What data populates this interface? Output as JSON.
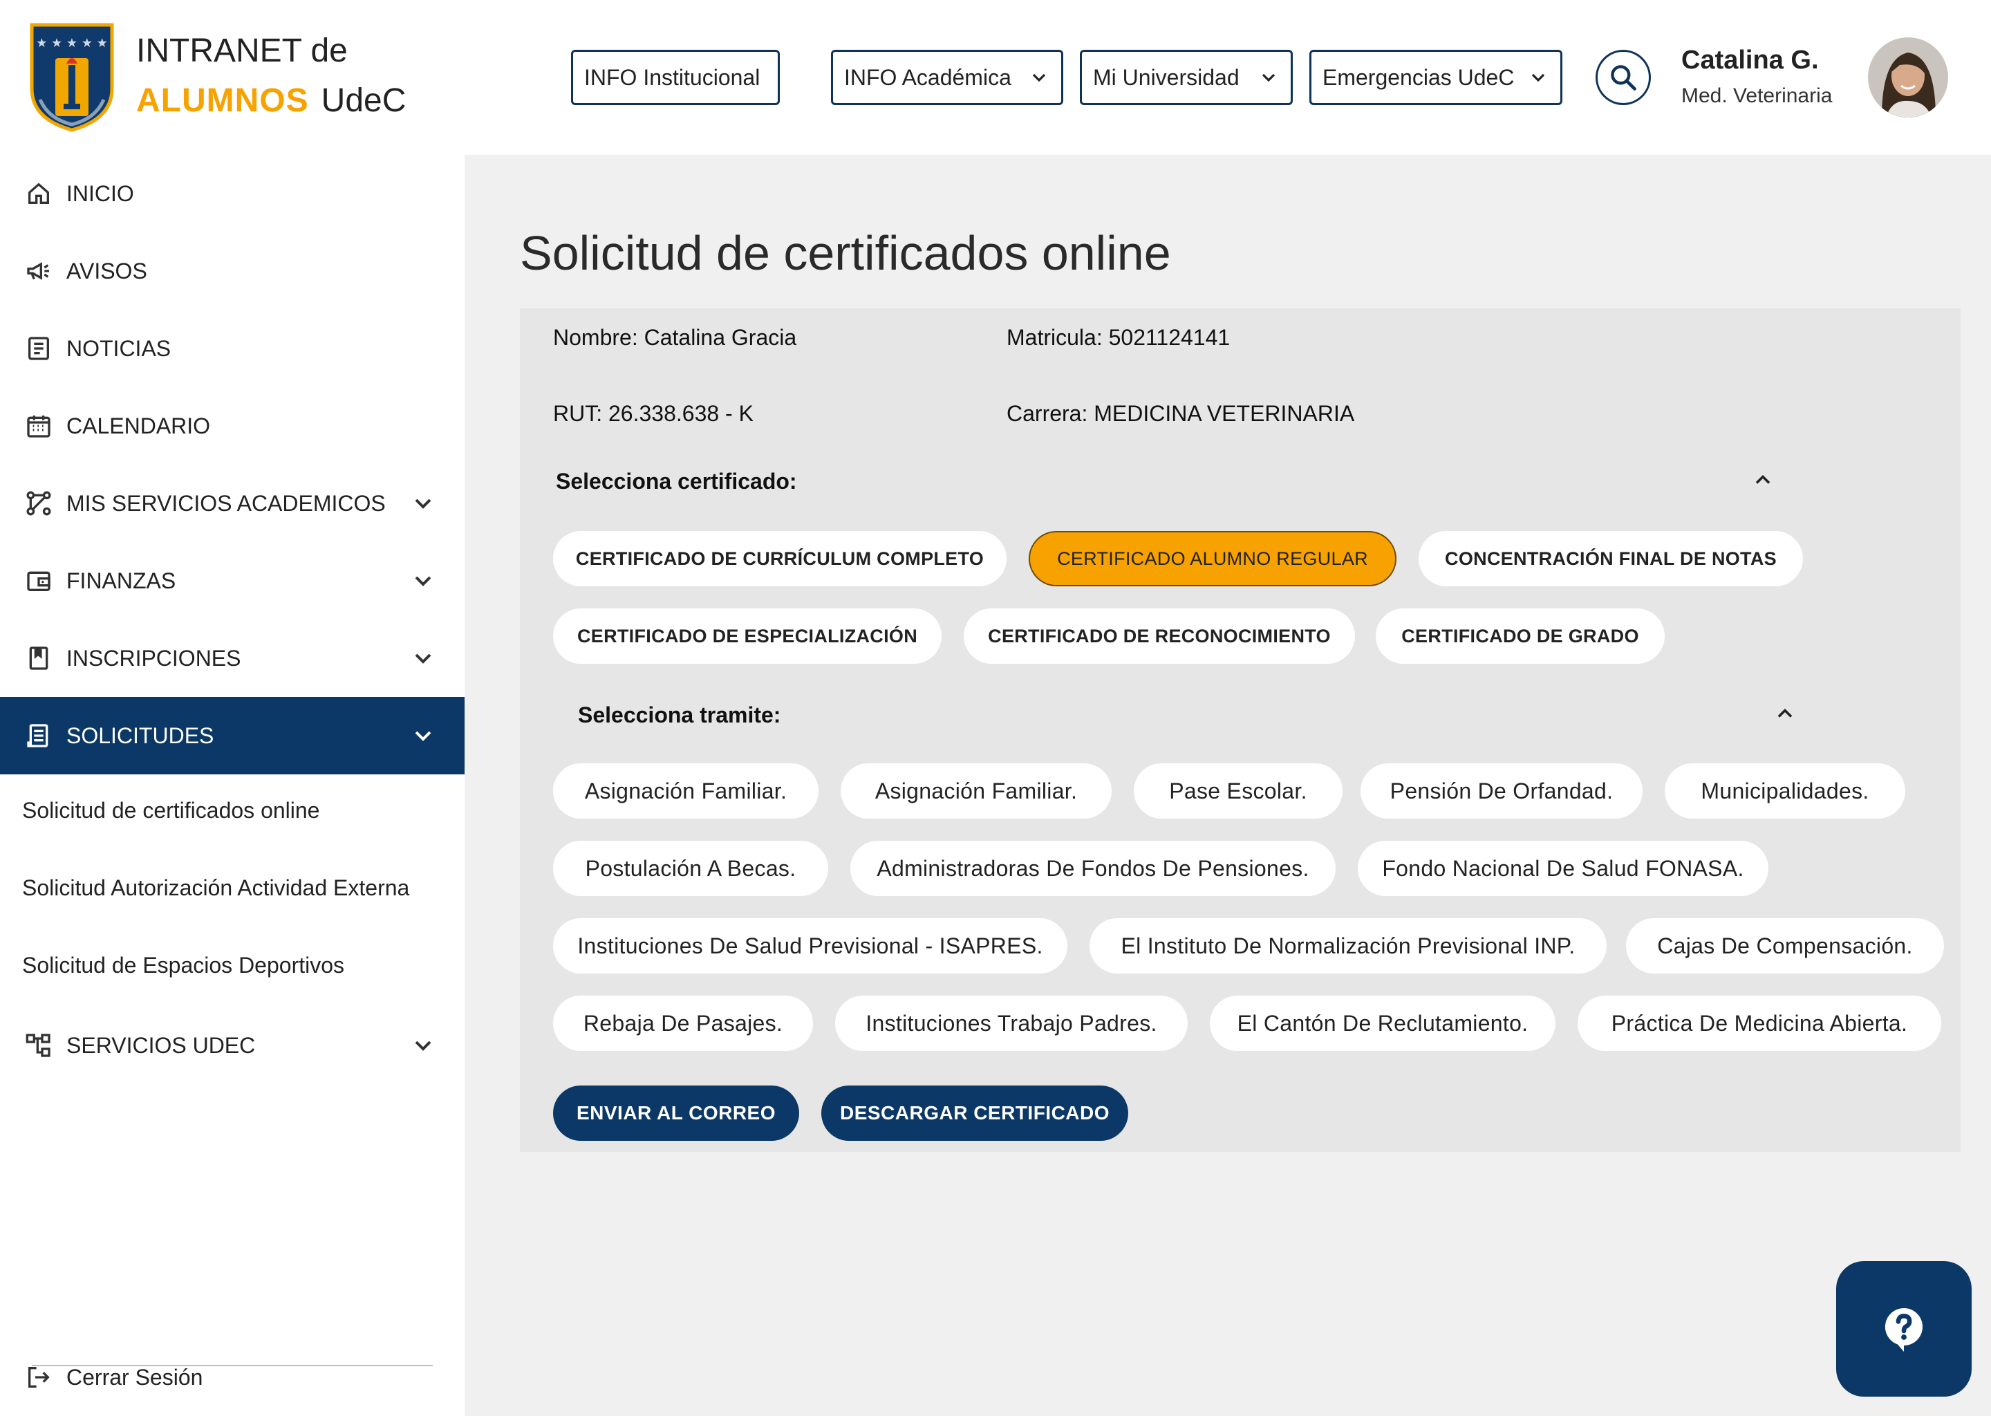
{
  "header": {
    "brand_line1": "INTRANET de",
    "brand_alumnos": "ALUMNOS",
    "brand_udec": "UdeC",
    "nav": [
      "INFO Institucional",
      "INFO Académica",
      "Mi Universidad",
      "Emergencias UdeC"
    ],
    "user_name": "Catalina G.",
    "user_career": "Med. Veterinaria"
  },
  "sidebar": {
    "items": [
      {
        "label": "INICIO",
        "icon": "home-icon"
      },
      {
        "label": "AVISOS",
        "icon": "megaphone-icon"
      },
      {
        "label": "NOTICIAS",
        "icon": "news-icon"
      },
      {
        "label": "CALENDARIO",
        "icon": "calendar-icon"
      },
      {
        "label": "MIS SERVICIOS ACADEMICOS",
        "icon": "services-icon"
      },
      {
        "label": "FINANZAS",
        "icon": "wallet-icon"
      },
      {
        "label": "INSCRIPCIONES",
        "icon": "bookmark-icon"
      },
      {
        "label": "SOLICITUDES",
        "icon": "document-icon"
      },
      {
        "label": "SERVICIOS UDEC",
        "icon": "network-icon"
      }
    ],
    "sub_items": [
      "Solicitud de certificados online",
      "Solicitud Autorización Actividad Externa",
      "Solicitud de Espacios Deportivos"
    ],
    "logout": "Cerrar Sesión"
  },
  "main": {
    "title": "Solicitud de certificados online",
    "student": {
      "name": "Nombre: Catalina Gracia",
      "matricula": "Matricula: 5021124141",
      "rut": "RUT: 26.338.638 - K",
      "carrera": "Carrera: MEDICINA VETERINARIA"
    },
    "cert_label": "Selecciona certificado:",
    "certificates": [
      "CERTIFICADO DE CURRÍCULUM COMPLETO",
      "CERTIFICADO  ALUMNO REGULAR",
      "CONCENTRACIÓN FINAL DE NOTAS",
      "CERTIFICADO DE ESPECIALIZACIÓN",
      "CERTIFICADO DE RECONOCIMIENTO",
      "CERTIFICADO DE GRADO"
    ],
    "selected_certificate": "CERTIFICADO  ALUMNO REGULAR",
    "tramite_label": "Selecciona tramite:",
    "tramites": [
      "Asignación Familiar.",
      "Asignación Familiar.",
      "Pase Escolar.",
      "Pensión De Orfandad.",
      "Municipalidades.",
      "Postulación A Becas.",
      "Administradoras De Fondos De Pensiones.",
      "Fondo Nacional De Salud FONASA.",
      "Instituciones De Salud Previsional - ISAPRES.",
      "El Instituto De Normalización Previsional INP.",
      "Cajas De Compensación.",
      "Rebaja De Pasajes.",
      "Instituciones Trabajo Padres.",
      "El Cantón De Reclutamiento.",
      "Práctica De Medicina Abierta."
    ],
    "actions": [
      "ENVIAR AL CORREO",
      "DESCARGAR CERTIFICADO"
    ]
  },
  "colors": {
    "primary": "#0b3866",
    "accent": "#f7a200",
    "main_bg": "#f0f0f0",
    "panel_bg": "#e6e6e6"
  }
}
